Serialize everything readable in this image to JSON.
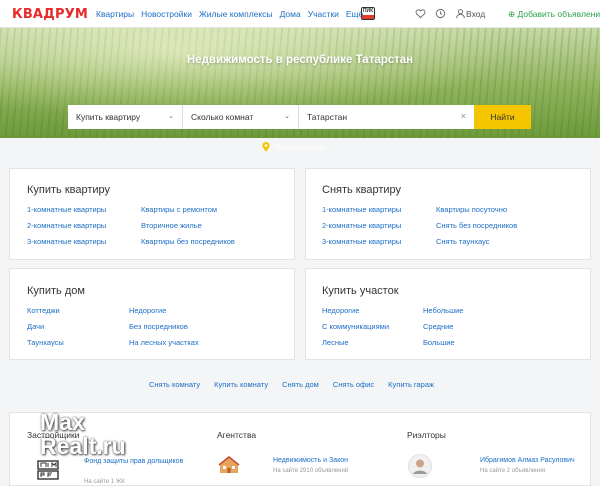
{
  "header": {
    "logo": "КВАДРУМ",
    "nav": [
      "Квартиры",
      "Новостройки",
      "Жилые комплексы",
      "Дома",
      "Участки",
      "Ещё ⌄"
    ],
    "pik_label": "ПИК",
    "login": "Вход",
    "add_ad": "Добавить объявление"
  },
  "hero": {
    "title": "Недвижимость в республике Татарстан",
    "deal_select": "Купить квартиру",
    "rooms_select": "Сколько комнат",
    "location_value": "Татарстан",
    "find_button": "Найти",
    "map_link": "Поиск на карте"
  },
  "cards": {
    "buy_flat": {
      "title": "Купить квартиру",
      "col1": [
        "1-комнатные квартиры",
        "2-комнатные квартиры",
        "3-комнатные квартиры"
      ],
      "col2": [
        "Квартиры с ремонтом",
        "Вторичное жилье",
        "Квартиры без посредников"
      ]
    },
    "rent_flat": {
      "title": "Снять квартиру",
      "col1": [
        "1-комнатные квартиры",
        "2-комнатные квартиры",
        "3-комнатные квартиры"
      ],
      "col2": [
        "Квартиры посуточно",
        "Снять без посредников",
        "Снять таунхаус"
      ]
    },
    "buy_house": {
      "title": "Купить дом",
      "col1": [
        "Коттеджи",
        "Дачи",
        "Таунхаусы"
      ],
      "col2": [
        "Недорогие",
        "Без посредников",
        "На лесных участках"
      ]
    },
    "buy_plot": {
      "title": "Купить участок",
      "col1": [
        "Недорогие",
        "С коммуникациями",
        "Лесные"
      ],
      "col2": [
        "Небольшие",
        "Средние",
        "Большие"
      ]
    }
  },
  "quick_links": [
    "Снять комнату",
    "Купить комнату",
    "Снять дом",
    "Снять офис",
    "Купить гараж"
  ],
  "bottom": {
    "developers_title": "Застройщики",
    "developer_name": "Фонд защиты прав дольщиков",
    "developer_sub": "На сайте 1 ЖК",
    "developer_logo_text": "ДОМ РФ",
    "agencies_title": "Агентства",
    "agency_name": "Недвижимость и Закон",
    "agency_sub": "На сайте 2910 объявлений",
    "realtors_title": "Риэлторы",
    "realtor_name": "Ибрагимов Алмаз Расулович",
    "realtor_sub": "На сайте 2 объявления"
  },
  "watermark": [
    "Max",
    "Realt.ru"
  ],
  "colors": {
    "brand_red": "#e52b2b",
    "link_blue": "#1c6ec5",
    "accent_yellow": "#f5c600",
    "add_green": "#2aa24a"
  }
}
